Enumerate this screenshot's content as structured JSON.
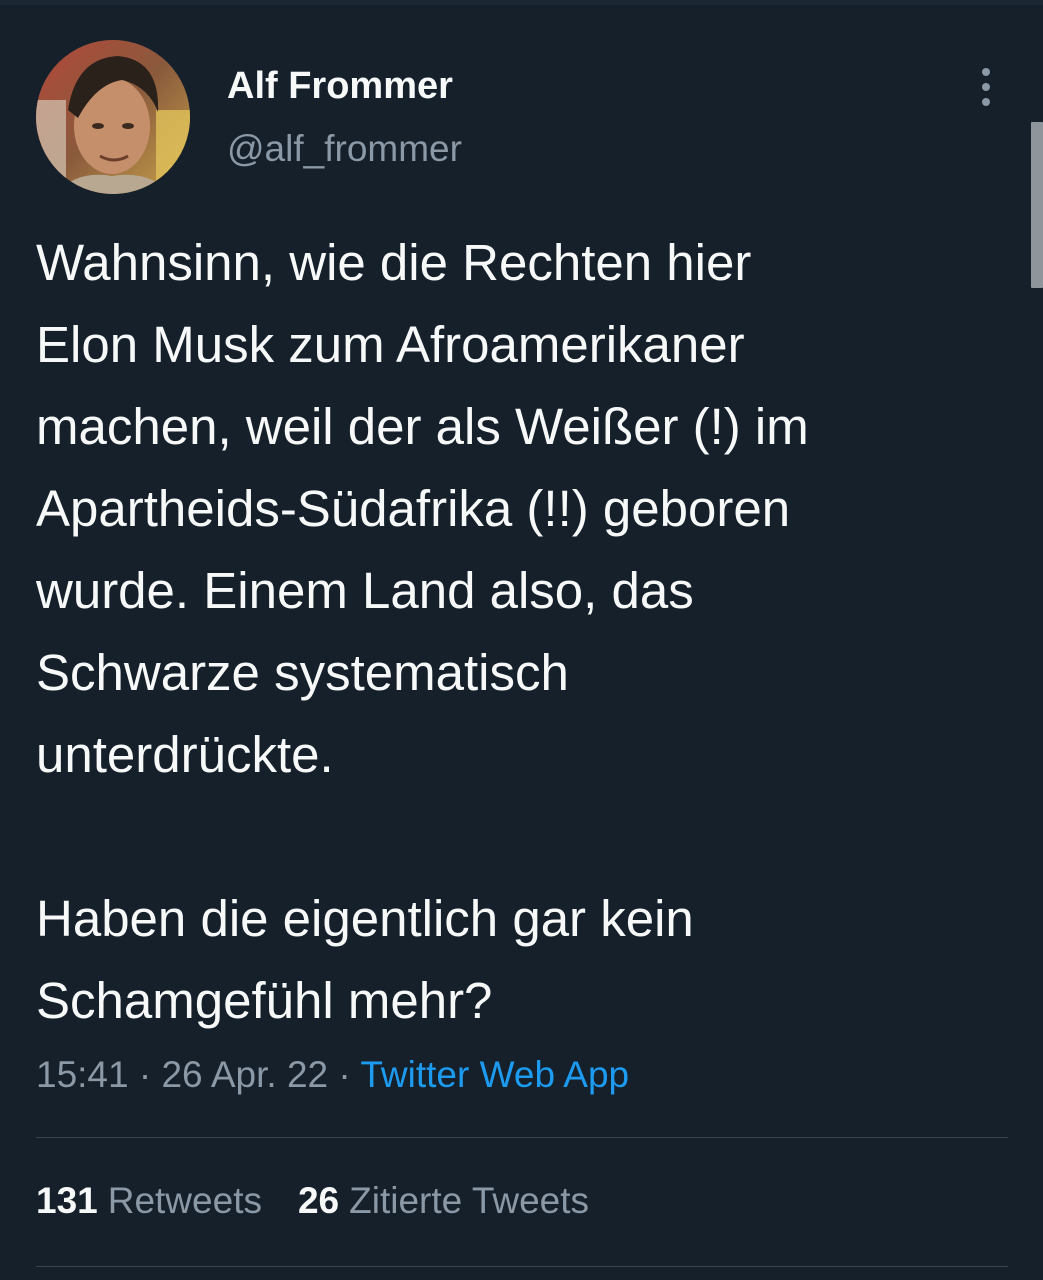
{
  "author": {
    "display_name": "Alf Frommer",
    "handle": "@alf_frommer",
    "avatar_icon": "profile-photo"
  },
  "tweet": {
    "paragraphs": [
      [
        "Wahnsinn, wie die Rechten hier",
        "Elon Musk zum Afroamerikaner",
        "machen, weil der als Weißer (!) im",
        "Apartheids-Südafrika (!!) geboren",
        "wurde. Einem Land also, das",
        "Schwarze systematisch",
        "unterdrückte."
      ],
      [
        "Haben die eigentlich gar kein",
        "Schamgefühl mehr?"
      ]
    ],
    "time": "15:41",
    "separator": "·",
    "date": "26 Apr. 22",
    "source": "Twitter Web App"
  },
  "stats": {
    "retweets_count": "131",
    "retweets_label": "Retweets",
    "quotes_count": "26",
    "quotes_label": "Zitierte Tweets"
  },
  "colors": {
    "background": "#15202b",
    "text": "#f7f9f9",
    "muted": "#8b98a5",
    "link": "#1d9bf0",
    "divider": "#38444d"
  },
  "icons": {
    "more": "more-vertical-icon"
  }
}
